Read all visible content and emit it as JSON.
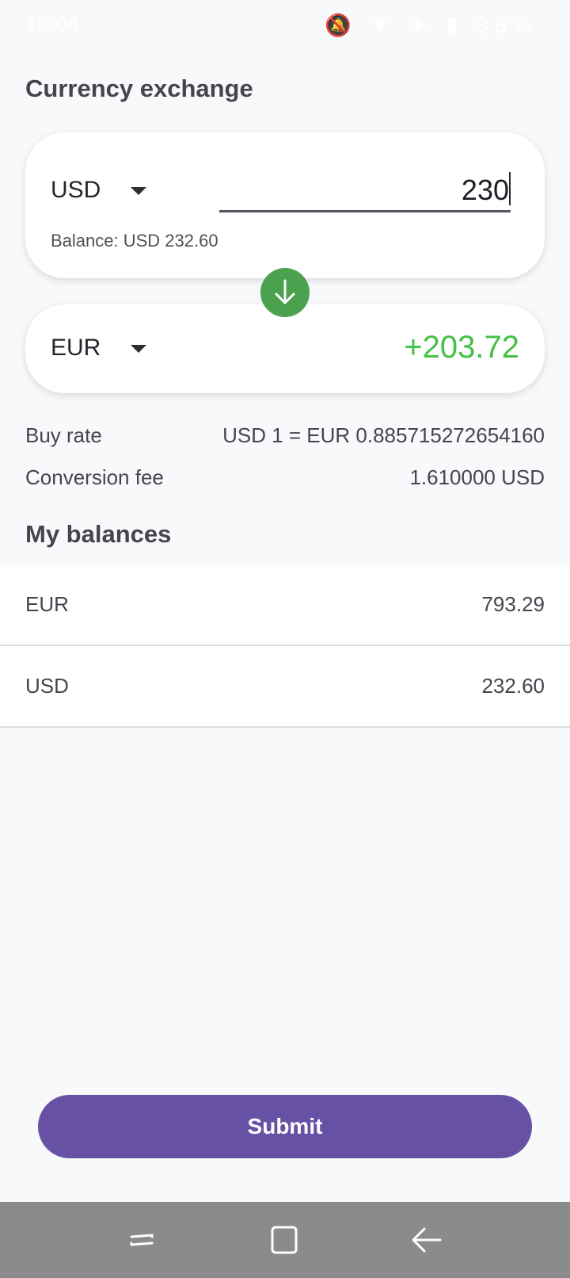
{
  "status_bar": {
    "time": "18:04",
    "battery": "38%"
  },
  "page": {
    "title": "Currency exchange"
  },
  "from_card": {
    "currency": "USD",
    "amount": "230",
    "balance_text": "Balance: USD 232.60"
  },
  "to_card": {
    "currency": "EUR",
    "amount": "+203.72"
  },
  "rates": {
    "buy_rate_label": "Buy rate",
    "buy_rate_value": "USD 1 = EUR 0.885715272654160",
    "fee_label": "Conversion fee",
    "fee_value": "1.610000 USD"
  },
  "balances": {
    "title": "My balances",
    "items": [
      {
        "currency": "EUR",
        "amount": "793.29"
      },
      {
        "currency": "USD",
        "amount": "232.60"
      }
    ]
  },
  "submit": {
    "label": "Submit"
  },
  "colors": {
    "accent": "#6651a4",
    "positive": "#44c144",
    "swap": "#4ca14e"
  },
  "icons": [
    "mute-icon",
    "wifi-icon",
    "airplane-icon",
    "battery-icon",
    "arrow-down-icon",
    "recent-apps-icon",
    "home-icon",
    "back-icon"
  ]
}
